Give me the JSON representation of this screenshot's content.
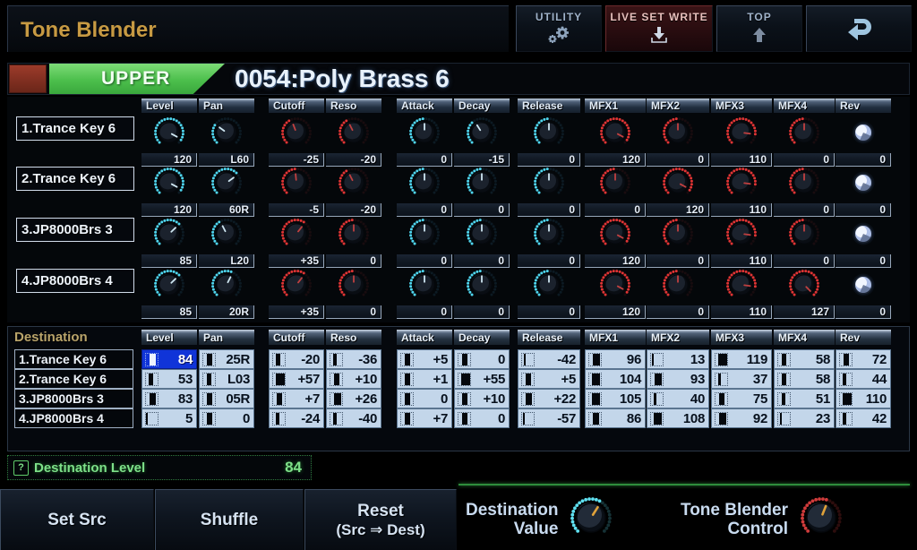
{
  "app": {
    "title": "Tone Blender"
  },
  "toolbar": {
    "utility": {
      "label": "UTILITY",
      "icon": "gear-icon"
    },
    "live_set_write": {
      "label": "LIVE SET WRITE",
      "icon": "download-arrow-icon"
    },
    "top": {
      "label": "TOP",
      "icon": "up-arrow-icon"
    },
    "exit": {
      "label": "",
      "icon": "return-arrow-icon"
    }
  },
  "patch": {
    "part_tab": "UPPER",
    "name": "0054:Poly Brass 6"
  },
  "columns": [
    "Level",
    "Pan",
    "Cutoff",
    "Reso",
    "Attack",
    "Decay",
    "Release",
    "MFX1",
    "MFX2",
    "MFX3",
    "MFX4",
    "Rev"
  ],
  "source": {
    "rows": [
      {
        "name": "1.Trance Key 6",
        "values": [
          "120",
          "L60",
          "-25",
          "-20",
          "0",
          "-15",
          "0",
          "120",
          "0",
          "110",
          "0",
          "0"
        ],
        "knob": [
          0.94,
          0.3,
          0.42,
          0.4,
          0.5,
          0.38,
          0.5,
          0.94,
          0.5,
          0.86,
          0.5,
          0.5
        ],
        "style": [
          "cyan",
          "cyan",
          "red",
          "red",
          "cyan",
          "cyan",
          "cyan",
          "red",
          "red",
          "red",
          "red",
          "rev"
        ]
      },
      {
        "name": "2.Trance Key 6",
        "values": [
          "120",
          "60R",
          "-5",
          "-20",
          "0",
          "0",
          "0",
          "0",
          "120",
          "110",
          "0",
          "0"
        ],
        "knob": [
          0.94,
          0.7,
          0.48,
          0.4,
          0.5,
          0.5,
          0.5,
          0.5,
          0.94,
          0.86,
          0.5,
          0.5
        ],
        "style": [
          "cyan",
          "cyan",
          "red",
          "red",
          "cyan",
          "cyan",
          "cyan",
          "red",
          "red",
          "red",
          "red",
          "rev"
        ]
      },
      {
        "name": "3.JP8000Brs 3",
        "values": [
          "85",
          "L20",
          "+35",
          "0",
          "0",
          "0",
          "0",
          "120",
          "0",
          "110",
          "0",
          "0"
        ],
        "knob": [
          0.67,
          0.4,
          0.64,
          0.5,
          0.5,
          0.5,
          0.5,
          0.94,
          0.5,
          0.86,
          0.5,
          0.5
        ],
        "style": [
          "cyan",
          "cyan",
          "red",
          "red",
          "cyan",
          "cyan",
          "cyan",
          "red",
          "red",
          "red",
          "red",
          "rev"
        ]
      },
      {
        "name": "4.JP8000Brs 4",
        "values": [
          "85",
          "20R",
          "+35",
          "0",
          "0",
          "0",
          "0",
          "120",
          "0",
          "110",
          "127",
          "0"
        ],
        "knob": [
          0.67,
          0.6,
          0.64,
          0.5,
          0.5,
          0.5,
          0.5,
          0.94,
          0.5,
          0.86,
          1.0,
          0.5
        ],
        "style": [
          "cyan",
          "cyan",
          "red",
          "red",
          "cyan",
          "cyan",
          "cyan",
          "red",
          "red",
          "red",
          "red",
          "rev"
        ]
      }
    ]
  },
  "destination": {
    "label": "Destination",
    "rows": [
      {
        "name": "1.Trance Key 6",
        "values": [
          "84",
          "25R",
          "-20",
          "-36",
          "+5",
          "0",
          "-42",
          "96",
          "13",
          "119",
          "58",
          "72"
        ],
        "meter": [
          0.66,
          0.5,
          0.42,
          0.36,
          0.55,
          0.5,
          0.17,
          0.76,
          0.1,
          0.94,
          0.46,
          0.57
        ]
      },
      {
        "name": "2.Trance Key 6",
        "values": [
          "53",
          "L03",
          "+57",
          "+10",
          "+1",
          "+55",
          "+5",
          "104",
          "93",
          "37",
          "58",
          "44"
        ],
        "meter": [
          0.42,
          0.47,
          0.95,
          0.58,
          0.51,
          0.93,
          0.54,
          0.82,
          0.73,
          0.29,
          0.46,
          0.35
        ]
      },
      {
        "name": "3.JP8000Brs 3",
        "values": [
          "83",
          "05R",
          "+7",
          "+26",
          "0",
          "+10",
          "+22",
          "105",
          "40",
          "75",
          "51",
          "110"
        ],
        "meter": [
          0.65,
          0.52,
          0.53,
          0.7,
          0.5,
          0.58,
          0.67,
          0.83,
          0.31,
          0.59,
          0.4,
          0.87
        ]
      },
      {
        "name": "4.JP8000Brs 4",
        "values": [
          "5",
          "0",
          "-24",
          "-40",
          "+7",
          "0",
          "-57",
          "86",
          "108",
          "92",
          "23",
          "42"
        ],
        "meter": [
          0.04,
          0.5,
          0.38,
          0.33,
          0.56,
          0.5,
          0.05,
          0.68,
          0.85,
          0.72,
          0.18,
          0.33
        ]
      }
    ]
  },
  "info": {
    "help_icon": "question-icon",
    "label": "Destination Level",
    "value": "84"
  },
  "footer": {
    "set_src": {
      "line1": "Set Src",
      "line2": ""
    },
    "shuffle": {
      "line1": "Shuffle",
      "line2": ""
    },
    "reset": {
      "line1": "Reset",
      "line2": "(Src ⇒ Dest)"
    },
    "destination_value": {
      "line1": "Destination",
      "line2": "Value",
      "knob_pos": 0.62
    },
    "tone_blender_control": {
      "line1": "Tone Blender",
      "line2": "Control",
      "knob_pos": 0.58
    }
  },
  "colors": {
    "accent_gold": "#c79a43",
    "tab_green": "#4cbf4c",
    "select_blue": "#1034d8",
    "knob_cyan": "#4fd6ef",
    "knob_red": "#e03030",
    "info_green": "#7ee089",
    "write_red": "#e8c0bc"
  }
}
